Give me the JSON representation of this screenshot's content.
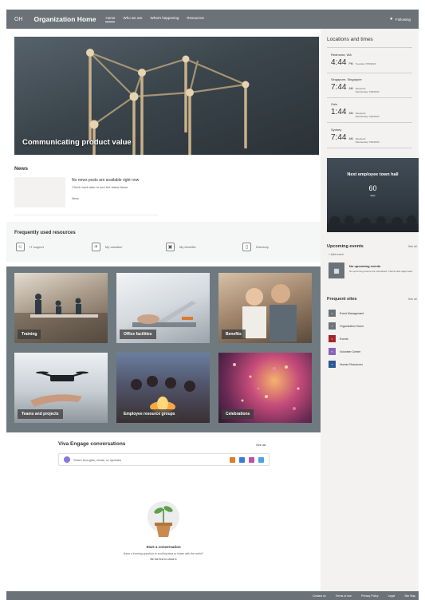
{
  "header": {
    "logo": "OH",
    "site_title": "Organization Home",
    "nav": [
      "Home",
      "Who we are",
      "What's happening",
      "Resources"
    ],
    "follow_label": "Following"
  },
  "hero": {
    "caption": "Communicating product value"
  },
  "news": {
    "title": "News",
    "headline": "No news posts are available right now",
    "subtext": "Check back later to see the latest News",
    "more": "News"
  },
  "frequent_resources": {
    "title": "Frequently used resources",
    "items": [
      {
        "label": "IT support",
        "icon": "person-icon"
      },
      {
        "label": "My vacation",
        "icon": "vacation-icon"
      },
      {
        "label": "My benefits",
        "icon": "briefcase-icon"
      },
      {
        "label": "Directory",
        "icon": "phone-icon"
      }
    ]
  },
  "gallery": {
    "tiles": [
      "Training",
      "Office facilities",
      "Benefits",
      "Teams and projects",
      "Employee resource groups",
      "Celebrations"
    ]
  },
  "viva": {
    "title": "Viva Engage conversations",
    "see_all": "See all",
    "placeholder": "Share thoughts, ideas, or updates",
    "empty_title": "Start a conversation",
    "empty_line1": "Have a burning question or exciting idea to share with the world?",
    "empty_line2": "Be the first to share it"
  },
  "locations": {
    "title": "Locations and times",
    "items": [
      {
        "city": "Redmond, WA",
        "time": "4:44",
        "ampm": "PM",
        "day": "",
        "date": "Tuesday 7/25/2023"
      },
      {
        "city": "Singapore, Singapore",
        "time": "7:44",
        "ampm": "AM",
        "day": "Weekend",
        "date": "Wednesday 7/26/2023"
      },
      {
        "city": "Oslo",
        "time": "1:44",
        "ampm": "AM",
        "day": "Weekend",
        "date": "Wednesday 7/26/2023"
      },
      {
        "city": "Sydney",
        "time": "7:44",
        "ampm": "AM",
        "day": "Weekend",
        "date": "Wednesday 7/26/2023"
      }
    ]
  },
  "townhall": {
    "title": "Next employee town hall",
    "count": "60",
    "unit": "days"
  },
  "upcoming": {
    "title": "Upcoming events",
    "see_all": "See all",
    "add": "+ Add event",
    "empty_title": "No upcoming events",
    "empty_text": "No upcoming events are scheduled. Check back again later."
  },
  "frequent_sites": {
    "title": "Frequent sites",
    "see_all": "See all",
    "items": [
      {
        "label": "Event Management",
        "color": "#6b7378"
      },
      {
        "label": "Organization Home",
        "color": "#6b7378"
      },
      {
        "label": "Events",
        "color": "#a4262c"
      },
      {
        "label": "Volunteer Center",
        "color": "#8764b8"
      },
      {
        "label": "Human Resources",
        "color": "#2b5797"
      }
    ]
  },
  "footer": {
    "links": [
      "Contact us",
      "Terms of use",
      "Privacy Policy",
      "Legal",
      "Site Map"
    ]
  },
  "colors": {
    "bar": "#6b7378",
    "accent": "#8378de"
  }
}
